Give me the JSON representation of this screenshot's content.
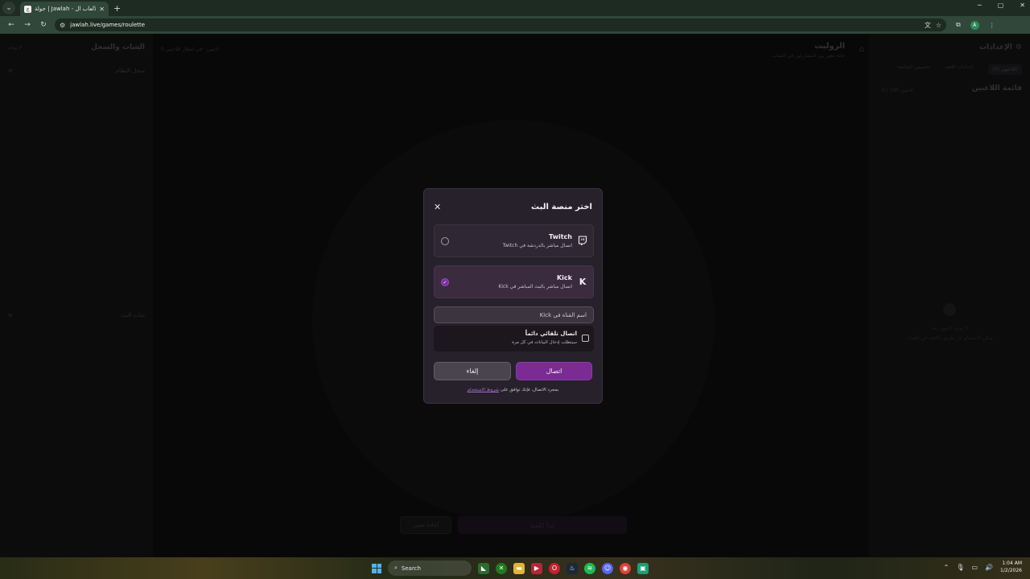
{
  "browser": {
    "tab_title": "جولة | Jawlah - منصة الألعاب ال...",
    "url": "jawlah.live/games/roulette",
    "profile_initial": "A"
  },
  "background": {
    "left_panel_title": "الشات والسجل",
    "left_panel_sub": "لا يوجد",
    "system_log_label": "سجل النظام",
    "stream_chat_label": "شات البث",
    "center_title": "الروليت",
    "center_sub": "خانة تتغير بين المشاركين في الشات",
    "center_meta": "0 لاعبين · في انتظار اللاعبين",
    "settings_title": "الإعدادات",
    "tabs": [
      "اللاعبون (0)",
      "إعدادات اللعبة",
      "تخصيص الشاشة"
    ],
    "players_list_title": "قائمة اللاعبين",
    "players_count": "0 / 100 لاعبين",
    "empty_line1": "لا يوجد لاعبون بعد",
    "empty_line2": "يمكن الانضمام عن طريق الكتابة في الشات",
    "reset_button": "إعادة تعيين",
    "start_button": "ابدأ اللعبة"
  },
  "modal": {
    "title": "اختر منصة البث",
    "options": [
      {
        "name": "Twitch",
        "description": "اتصال مباشر بالدردشة في Twitch",
        "icon": "twitch-icon",
        "selected": false
      },
      {
        "name": "Kick",
        "description": "اتصال مباشر بالبث المباشر في Kick",
        "icon": "kick-icon",
        "selected": true
      }
    ],
    "channel_placeholder": "اسم القناة في Kick",
    "auto_connect_label": "اتصال تلقائي دائماً",
    "auto_connect_sub": "سيتطلب إدخال البيانات في كل مرة",
    "connect_button": "اتصال",
    "cancel_button": "إلغاء",
    "terms_text": "بمجرد الاتصال، فإنك توافق على",
    "terms_link": "شروط الاستخدام"
  },
  "taskbar": {
    "search_placeholder": "Search",
    "time": "1:04 AM",
    "date": "1/2/2026"
  },
  "colors": {
    "accent": "#7a2b94",
    "modal_bg": "#26212a"
  }
}
